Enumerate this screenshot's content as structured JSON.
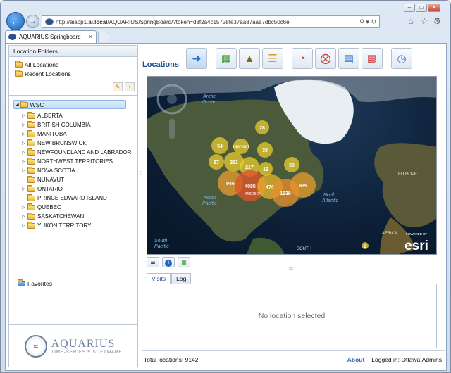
{
  "browser": {
    "url_prefix": "http://aiapp1.",
    "url_host": "ai.local",
    "url_rest": "/AQUARIUS/SpringBoard/?token=d8f2a4c15728fe37aa87aaa7dbc50c6e",
    "tab_title": "AQUARIUS Springboard"
  },
  "left_panel": {
    "header": "Location Folders",
    "links": [
      "All Locations",
      "Recent Locations"
    ],
    "tree_root": "WSC",
    "tree_items": [
      {
        "label": "ALBERTA",
        "expandable": true
      },
      {
        "label": "BRITISH COLUMBIA",
        "expandable": true
      },
      {
        "label": "MANITOBA",
        "expandable": true
      },
      {
        "label": "NEW BRUNSWICK",
        "expandable": true
      },
      {
        "label": "NEWFOUNDLAND AND LABRADOR",
        "expandable": true
      },
      {
        "label": "NORTHWEST TERRITORIES",
        "expandable": true
      },
      {
        "label": "NOVA SCOTIA",
        "expandable": true
      },
      {
        "label": "NUNAVUT",
        "expandable": false
      },
      {
        "label": "ONTARIO",
        "expandable": true
      },
      {
        "label": "PRINCE EDWARD ISLAND",
        "expandable": false
      },
      {
        "label": "QUEBEC",
        "expandable": true
      },
      {
        "label": "SASKATCHEWAN",
        "expandable": true
      },
      {
        "label": "YUKON TERRITORY",
        "expandable": true
      }
    ],
    "favorites": "Favorites",
    "logo_name": "AQUARIUS",
    "logo_tagline": "TIME-SERIES™ SOFTWARE"
  },
  "main": {
    "title": "Locations",
    "toolbar_icons": [
      "arrow-right-icon",
      "map-icon",
      "boots-icon",
      "folder-chart-icon",
      "gauge-icon",
      "compass-icon",
      "chart-icon",
      "grid-chart-icon",
      "clock-icon"
    ],
    "map": {
      "labels": {
        "arctic_ocean_1": "Arctic",
        "arctic_ocean_2": "Ocean",
        "north_pacific_1": "North",
        "north_pacific_2": "Pacific",
        "north_atlantic_1": "North",
        "north_atlantic_2": "Atlantic",
        "south_pacific_1": "South",
        "south_pacific_2": "Pacific",
        "europe": "EU ROPE",
        "africa": "AFRICA",
        "south": "SOUTH",
        "america": "AMERICA",
        "esri_powered": "POWERED BY",
        "esri": "esri"
      },
      "clusters": [
        {
          "label": "28"
        },
        {
          "label": "54"
        },
        {
          "label": "100C001"
        },
        {
          "label": "38"
        },
        {
          "label": "67"
        },
        {
          "label": "251"
        },
        {
          "label": "217"
        },
        {
          "label": "16"
        },
        {
          "label": "59"
        },
        {
          "label": "946"
        },
        {
          "label": "4085"
        },
        {
          "label": "470"
        },
        {
          "label": "939"
        },
        {
          "label": "1939"
        },
        {
          "label": "2"
        }
      ]
    },
    "tabs": [
      "Visits",
      "Log"
    ],
    "empty_message": "No location selected",
    "status": {
      "total": "Total locations: 9142",
      "about": "About",
      "logged_in": "Logged in: Ottawa.Admins"
    }
  }
}
